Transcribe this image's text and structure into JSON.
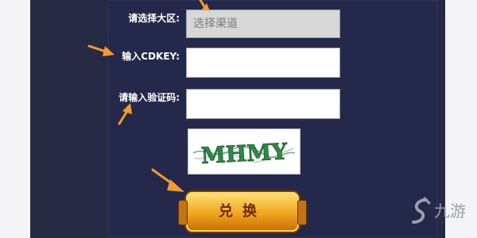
{
  "form": {
    "region_label": "请选择大区:",
    "region_select_value": "选择渠道",
    "cdkey_label": "输入CDKEY:",
    "cdkey_value": "",
    "captcha_label": "请输入验证码:",
    "captcha_value": "",
    "captcha_text": "MHMY",
    "redeem_label": "兑换"
  },
  "watermark": {
    "text": "九游"
  },
  "colors": {
    "panel_bg": "#262a44",
    "annotation_arrow": "#f39a2a",
    "button_gold": "#f0a51a",
    "captcha_green": "#2c8a45"
  },
  "icons": [
    "annotation-arrow",
    "jiuyou-logo-icon"
  ]
}
